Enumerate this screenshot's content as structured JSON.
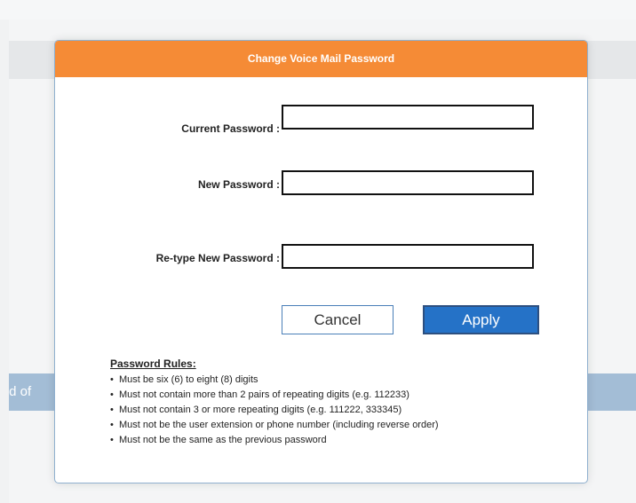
{
  "background": {
    "partial_text": "word of"
  },
  "dialog": {
    "title": "Change Voice Mail Password",
    "header_color": "#f58b36",
    "fields": {
      "current_label": "Current Password :",
      "current_value": "",
      "new_label": "New Password :",
      "new_value": "",
      "retype_label": "Re-type New Password :",
      "retype_value": ""
    },
    "buttons": {
      "cancel": "Cancel",
      "apply": "Apply",
      "apply_color": "#2572c7"
    },
    "rules": {
      "title": "Password Rules:",
      "bullet": "•",
      "items": [
        "Must be six (6) to eight (8) digits",
        "Must not contain more than 2 pairs of repeating digits (e.g. 112233)",
        "Must not contain 3 or more repeating digits (e.g. 111222, 333345)",
        "Must not be the user extension or phone number (including reverse order)",
        "Must not be the same as the previous password"
      ]
    }
  }
}
